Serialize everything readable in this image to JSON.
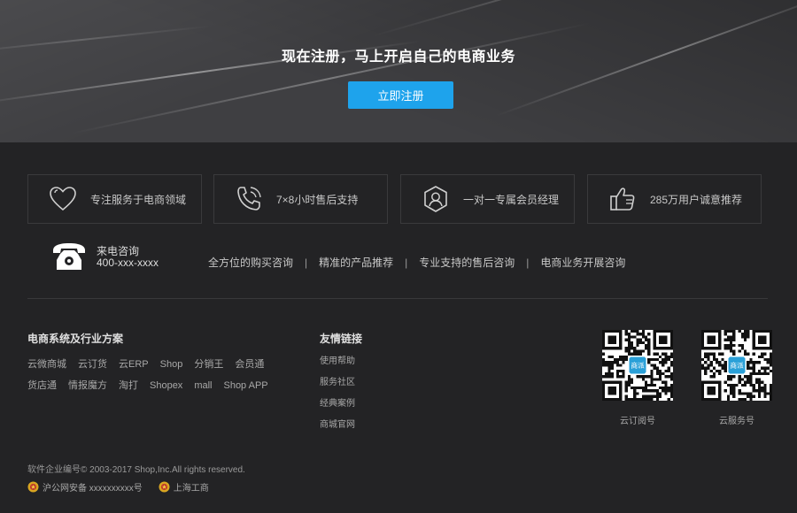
{
  "hero": {
    "title": "现在注册，马上开启自己的电商业务",
    "button_label": "立即注册"
  },
  "features": [
    {
      "icon": "heart-icon",
      "text": "专注服务于电商领域"
    },
    {
      "icon": "phone-call-icon",
      "text": "7×8小时售后支持"
    },
    {
      "icon": "user-shield-icon",
      "text": "一对一专属会员经理"
    },
    {
      "icon": "thumbs-up-icon",
      "text": "285万用户诚意推荐"
    }
  ],
  "consult": {
    "label": "来电咨询",
    "number": "400-xxx-xxxx",
    "links": [
      "全方位的购买咨询",
      "精准的产品推荐",
      "专业支持的售后咨询",
      "电商业务开展咨询"
    ],
    "separator": "|"
  },
  "solutions": {
    "title": "电商系统及行业方案",
    "row1": [
      "云微商城",
      "云订货",
      "云ERP",
      "Shop",
      "分销王",
      "会员通"
    ],
    "row2": [
      "货店通",
      "情报魔方",
      "淘打",
      "Shopex",
      "mall",
      "Shop APP"
    ]
  },
  "friends": {
    "title": "友情链接",
    "links": [
      "使用帮助",
      "服务社区",
      "经典案例",
      "商城官网"
    ]
  },
  "qrcodes": [
    {
      "label": "云订阅号",
      "center_text": "商派"
    },
    {
      "label": "云服务号",
      "center_text": "商派"
    }
  ],
  "footer": {
    "copyright": "软件企业编号© 2003-2017 Shop,Inc.All rights reserved.",
    "record1": "沪公网安备 xxxxxxxxxx号",
    "record2": "上海工商"
  },
  "colors": {
    "accent": "#1ea3ec",
    "footer_bg": "#232325",
    "hero_bg": "#3f3f42"
  }
}
